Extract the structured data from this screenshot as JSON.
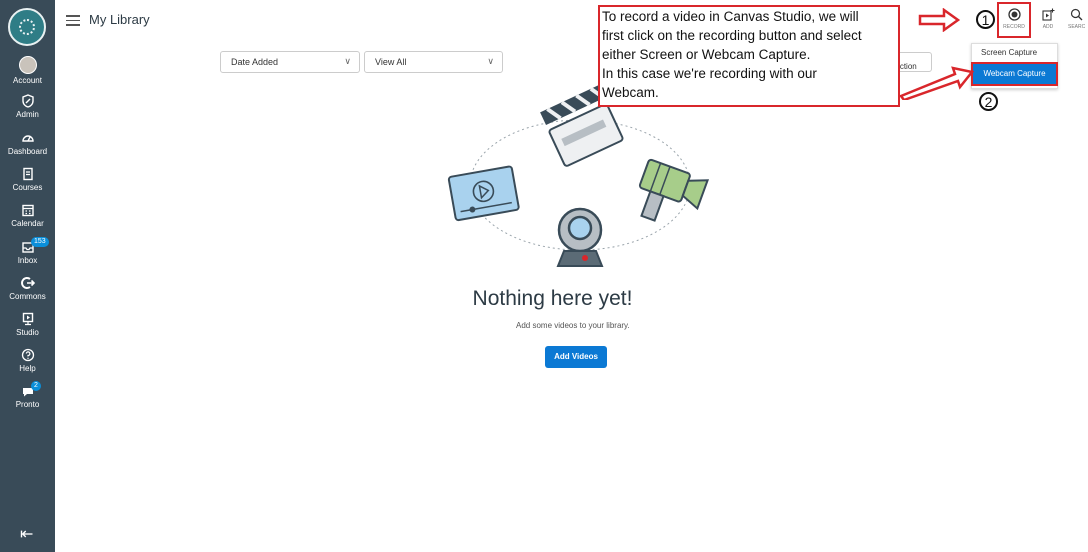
{
  "header": {
    "title": "My Library",
    "record_label": "RECORD",
    "add_label": "ADD",
    "search_label": "SEARC"
  },
  "nav": {
    "items": [
      {
        "label": "Account",
        "icon": "avatar"
      },
      {
        "label": "Admin",
        "icon": "shield-icon"
      },
      {
        "label": "Dashboard",
        "icon": "gauge-icon"
      },
      {
        "label": "Courses",
        "icon": "book-icon"
      },
      {
        "label": "Calendar",
        "icon": "calendar-icon"
      },
      {
        "label": "Inbox",
        "icon": "inbox-icon",
        "badge": "153"
      },
      {
        "label": "Commons",
        "icon": "commons-icon"
      },
      {
        "label": "Studio",
        "icon": "studio-icon"
      },
      {
        "label": "Help",
        "icon": "help-icon"
      },
      {
        "label": "Pronto",
        "icon": "chat-icon",
        "badge": "2"
      }
    ]
  },
  "filters": {
    "sort": "Date Added",
    "view": "View All",
    "collection_label": "Collection"
  },
  "empty": {
    "title": "Nothing here yet!",
    "subtitle": "Add some videos to your library.",
    "button": "Add Videos"
  },
  "record_menu": {
    "option1": "Screen Capture",
    "option2": "Webcam Capture"
  },
  "annotation": {
    "line1": "To record a video in Canvas Studio, we will",
    "line2": "first click on the recording button and select",
    "line3": "either Screen or Webcam Capture.",
    "line4": "In this case we're recording with our",
    "line5": "Webcam.",
    "step1": "1",
    "step2": "2"
  },
  "colors": {
    "nav_bg": "#394b58",
    "accent": "#0b79d4",
    "annotation_red": "#d9262b"
  }
}
